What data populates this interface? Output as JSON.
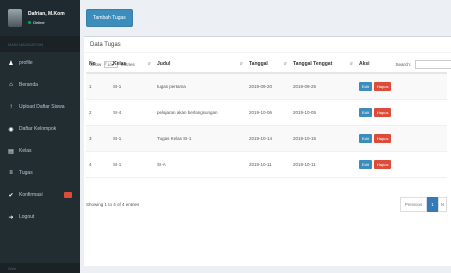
{
  "sidebar": {
    "user_name": "Dafrian, M.Kom",
    "user_status": "Online",
    "nav_header": "MAIN NAVIGATION",
    "items": [
      {
        "icon": "user-icon",
        "glyph": "♟",
        "label": "profile"
      },
      {
        "icon": "home-icon",
        "glyph": "⌂",
        "label": "Beranda"
      },
      {
        "icon": "upload-icon",
        "glyph": "↑",
        "label": "Upload Daftar Siswa"
      },
      {
        "icon": "users-icon",
        "glyph": "◉",
        "label": "Daftar Kelompok"
      },
      {
        "icon": "book-icon",
        "glyph": "▤",
        "label": "Kelas"
      },
      {
        "icon": "tasks-icon",
        "glyph": "≡",
        "label": "Tugas"
      },
      {
        "icon": "check-icon",
        "glyph": "✔",
        "label": "Konfirmasi"
      },
      {
        "icon": "logout-icon",
        "glyph": "➜",
        "label": "Logout"
      }
    ],
    "footer": "Web"
  },
  "toolbar": {
    "add_label": "Tambah Tugas"
  },
  "box": {
    "title": "Data Tugas"
  },
  "controls": {
    "show_label": "Show",
    "entries_value": "10",
    "entries_label": "entries",
    "search_label": "Search:",
    "search_placeholder": ""
  },
  "table": {
    "columns": [
      "No",
      "Kelas",
      "Judul",
      "Tanggal",
      "Tanggal Tenggat",
      "Aksi"
    ],
    "rows": [
      {
        "no": "1",
        "kelas": "SI-1",
        "judul": "tugas pertama",
        "tanggal": "2019-09-20",
        "tenggat": "2019-09-25"
      },
      {
        "no": "2",
        "kelas": "SI-4",
        "judul": "pelajaran akan berlangsungan",
        "tanggal": "2019-10-06",
        "tenggat": "2019-10-05"
      },
      {
        "no": "3",
        "kelas": "SI-1",
        "judul": "Tugas Kelas SI-1",
        "tanggal": "2019-10-14",
        "tenggat": "2019-10-15"
      },
      {
        "no": "4",
        "kelas": "SI-1",
        "judul": "SI-A",
        "tanggal": "2019-10-11",
        "tenggat": "2019-10-11"
      }
    ],
    "edit_label": "Edit",
    "delete_label": "Hapus"
  },
  "footer": {
    "info": "Showing 1 to 4 of 4 entries",
    "prev_label": "Previous",
    "page": "1",
    "next_label": "N"
  },
  "colors": {
    "sidebar": "#222d32",
    "primary": "#3c8dbc",
    "danger": "#dd4b39",
    "online": "#00a65a"
  }
}
